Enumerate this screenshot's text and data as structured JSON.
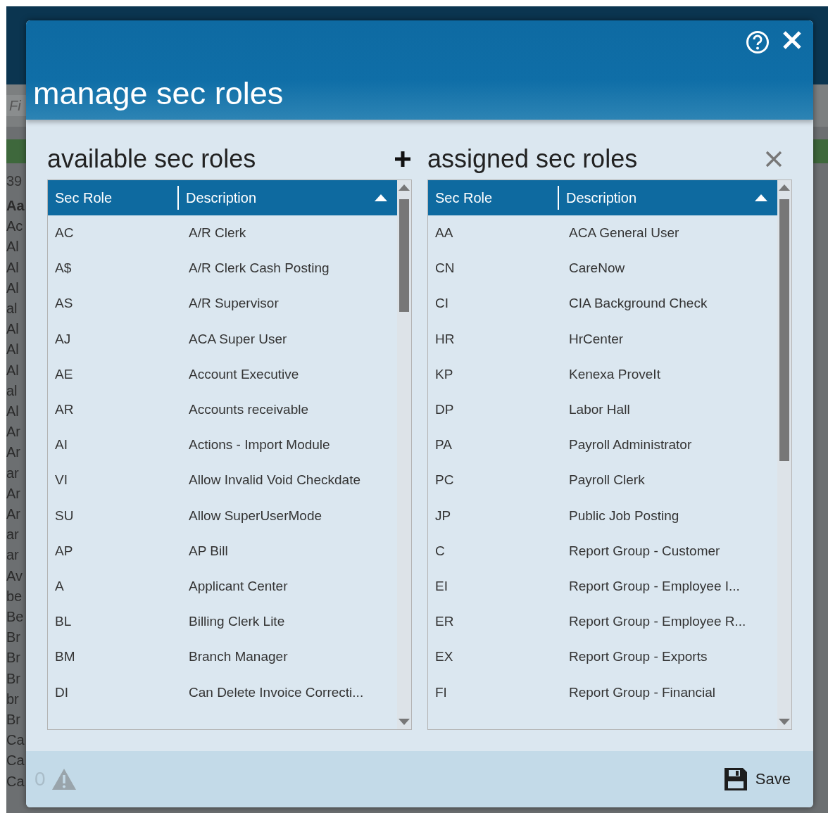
{
  "background": {
    "search_placeholder": "Fi",
    "count": "39",
    "list": [
      "Aa",
      "Ac",
      "Al",
      "Al",
      "Al",
      "al",
      "Al",
      "Al",
      "Al",
      "al",
      "Al",
      "Ar",
      "Ar",
      "ar",
      "Ar",
      "Ar",
      "ar",
      "ar",
      "Av",
      "be",
      "Be",
      "Br",
      "Br",
      "Br",
      "br",
      "Br",
      "Ca",
      "Ca",
      "Ca"
    ]
  },
  "dialog": {
    "title": "manage sec roles"
  },
  "panels": [
    {
      "title": "available sec roles",
      "columns": [
        {
          "label": "Sec Role",
          "sorted": false
        },
        {
          "label": "Description",
          "sorted": true
        }
      ],
      "rows": [
        [
          "AC",
          "A/R Clerk"
        ],
        [
          "A$",
          "A/R Clerk Cash Posting"
        ],
        [
          "AS",
          "A/R Supervisor"
        ],
        [
          "AJ",
          "ACA Super User"
        ],
        [
          "AE",
          "Account Executive"
        ],
        [
          "AR",
          "Accounts receivable"
        ],
        [
          "AI",
          "Actions - Import Module"
        ],
        [
          "VI",
          "Allow Invalid Void Checkdate"
        ],
        [
          "SU",
          "Allow SuperUserMode"
        ],
        [
          "AP",
          "AP Bill"
        ],
        [
          "A",
          "Applicant Center"
        ],
        [
          "BL",
          "Billing Clerk Lite"
        ],
        [
          "BM",
          "Branch Manager"
        ],
        [
          "DI",
          "Can Delete Invoice Correcti..."
        ]
      ]
    },
    {
      "title": "assigned sec roles",
      "columns": [
        {
          "label": "Sec Role",
          "sorted": false
        },
        {
          "label": "Description",
          "sorted": true
        }
      ],
      "rows": [
        [
          "AA",
          "ACA General User"
        ],
        [
          "CN",
          "CareNow"
        ],
        [
          "CI",
          "CIA Background Check"
        ],
        [
          "HR",
          "HrCenter"
        ],
        [
          "KP",
          "Kenexa ProveIt"
        ],
        [
          "DP",
          "Labor Hall"
        ],
        [
          "PA",
          "Payroll Administrator"
        ],
        [
          "PC",
          "Payroll Clerk"
        ],
        [
          "JP",
          "Public Job Posting"
        ],
        [
          "C",
          "Report Group - Customer"
        ],
        [
          "EI",
          "Report Group - Employee I..."
        ],
        [
          "ER",
          "Report Group - Employee R..."
        ],
        [
          "EX",
          "Report Group - Exports"
        ],
        [
          "FI",
          "Report Group - Financial"
        ]
      ]
    }
  ],
  "footer": {
    "warning_count": "0",
    "save_label": "Save"
  }
}
